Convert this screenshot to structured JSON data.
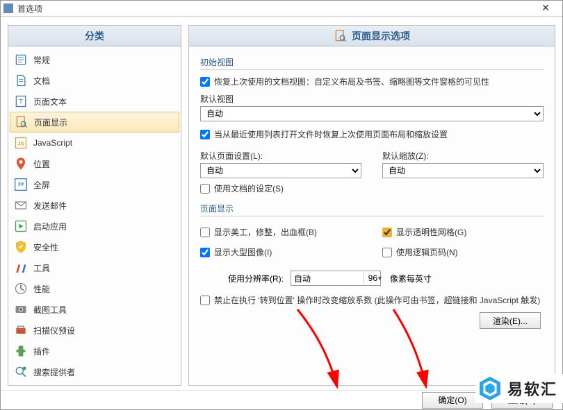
{
  "window": {
    "title": "首选项"
  },
  "sidebar": {
    "header": "分类",
    "items": [
      {
        "label": "常规"
      },
      {
        "label": "文档"
      },
      {
        "label": "页面文本"
      },
      {
        "label": "页面显示",
        "selected": true
      },
      {
        "label": "JavaScript"
      },
      {
        "label": "位置"
      },
      {
        "label": "全屏"
      },
      {
        "label": "发送邮件"
      },
      {
        "label": "启动应用"
      },
      {
        "label": "安全性"
      },
      {
        "label": "工具"
      },
      {
        "label": "性能"
      },
      {
        "label": "截图工具"
      },
      {
        "label": "扫描仪预设"
      },
      {
        "label": "插件"
      },
      {
        "label": "搜索提供者"
      }
    ]
  },
  "main": {
    "header": "页面显示选项",
    "initial_view": {
      "title": "初始视图",
      "restore_last": "恢复上次使用的文档视图：自定义布局及书签、缩略图等文件窗格的可见性",
      "default_view_label": "默认视图",
      "default_view_value": "自动",
      "restore_from_list": "当从最近使用列表打开文件时恢复上次使用页面布局和缩放设置",
      "default_page_label": "默认页面设置(L):",
      "default_page_value": "自动",
      "default_zoom_label": "默认缩放(Z):",
      "default_zoom_value": "自动",
      "use_doc_settings": "使用文档的设定(S)"
    },
    "page_display": {
      "title": "页面显示",
      "show_art": "显示美工，修整，出血框(B)",
      "show_large": "显示大型图像(I)",
      "show_trans_grid": "显示透明性网格(G)",
      "use_logical": "使用逻辑页码(N)",
      "resolution_label": "使用分辨率(R):",
      "resolution_mode": "自动",
      "resolution_value": "96",
      "resolution_unit": "像素每英寸",
      "prohibit_text": "禁止在执行 '转到位置' 操作时改变缩放系数 (此操作可由书签，超链接和 JavaScript 触发)",
      "render_btn": "渲染(E)..."
    }
  },
  "footer": {
    "ok": "确定(O)",
    "apply": "应用(A)"
  },
  "watermark": {
    "text": "易软汇"
  }
}
